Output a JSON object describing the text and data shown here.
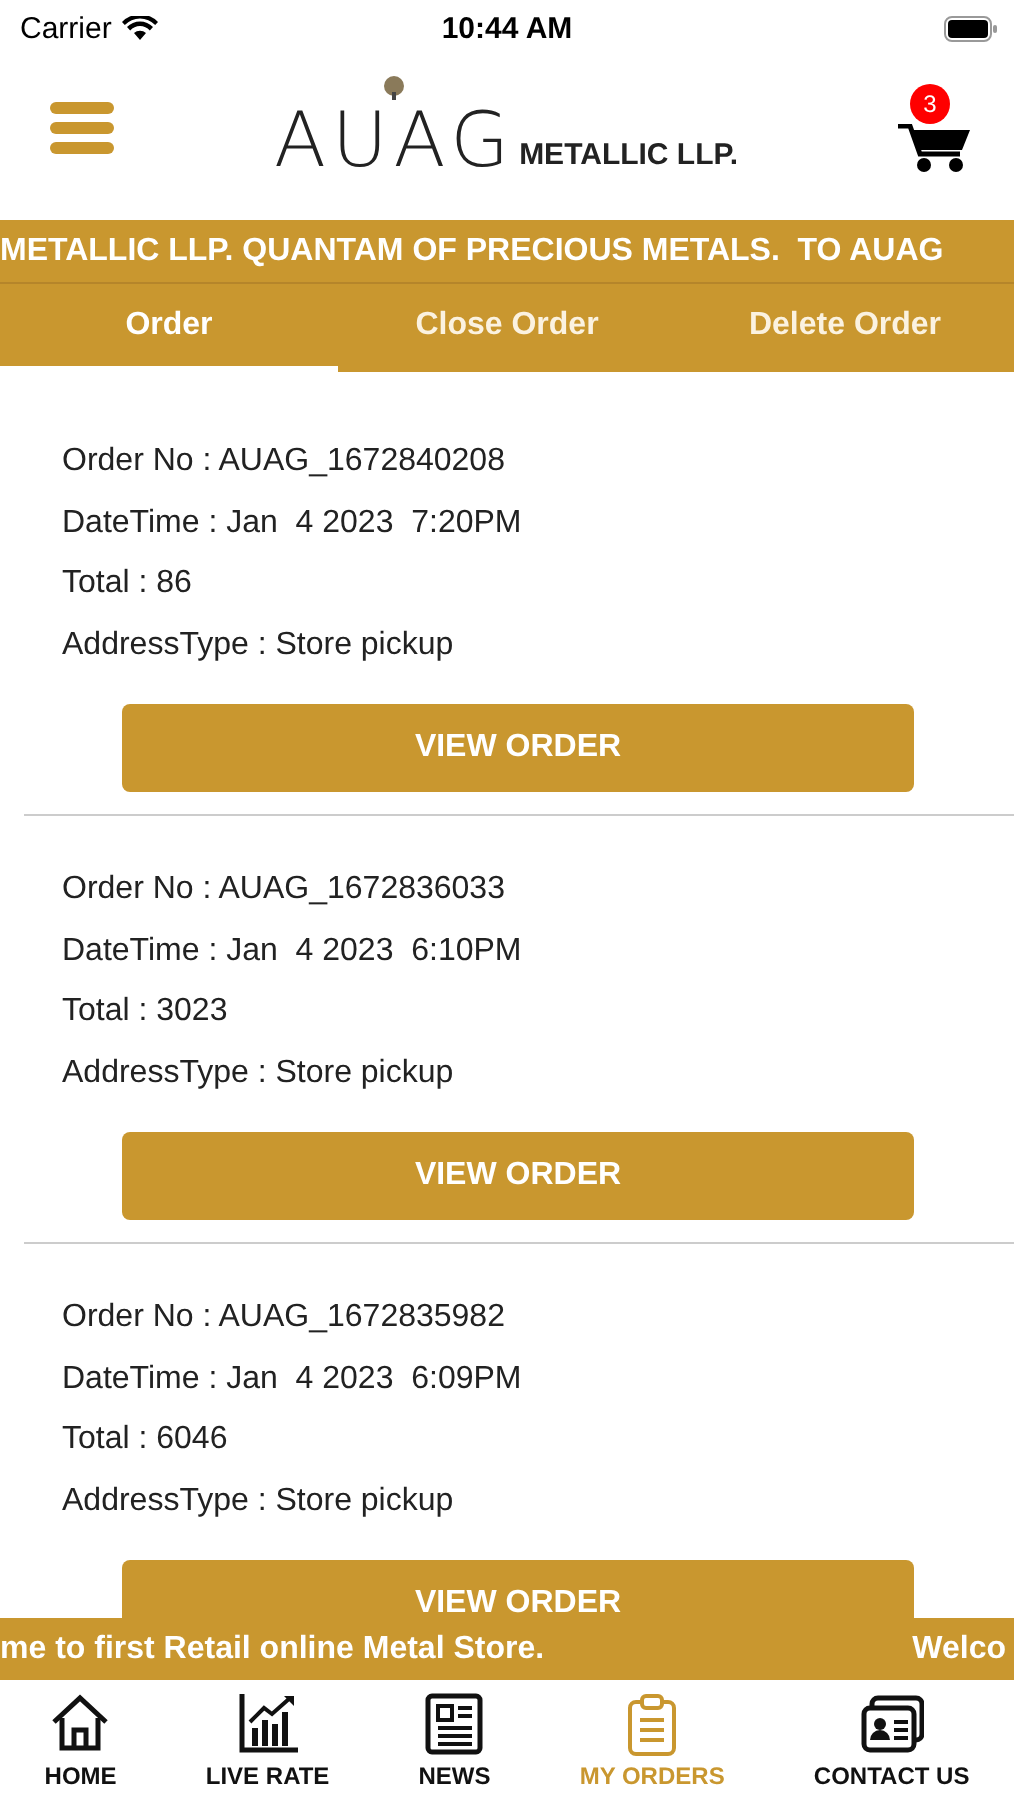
{
  "status_bar": {
    "carrier": "Carrier",
    "time": "10:44 AM"
  },
  "header": {
    "logo_letters": "AUAG",
    "logo_suffix": "METALLIC LLP.",
    "cart_count": "3"
  },
  "top_ticker": "METALLIC LLP. QUANTAM OF PRECIOUS METALS.  TO AUAG",
  "tabs": [
    {
      "label": "Order",
      "selected": true
    },
    {
      "label": "Close Order",
      "selected": false
    },
    {
      "label": "Delete Order",
      "selected": false
    }
  ],
  "orders": [
    {
      "order_no": "Order No : AUAG_1672840208",
      "datetime": "DateTime : Jan  4 2023  7:20PM",
      "total": "Total : 86",
      "address_type": "AddressType : Store pickup",
      "button": "VIEW ORDER"
    },
    {
      "order_no": "Order No : AUAG_1672836033",
      "datetime": "DateTime : Jan  4 2023  6:10PM",
      "total": "Total : 3023",
      "address_type": "AddressType : Store pickup",
      "button": "VIEW ORDER"
    },
    {
      "order_no": "Order No : AUAG_1672835982",
      "datetime": "DateTime : Jan  4 2023  6:09PM",
      "total": "Total : 6046",
      "address_type": "AddressType : Store pickup",
      "button": "VIEW ORDER"
    }
  ],
  "bottom_ticker": [
    "me to first Retail online Metal Store.",
    "Welco"
  ],
  "tab_bar": [
    {
      "kind": "home",
      "label": "HOME",
      "selected": false
    },
    {
      "kind": "chart",
      "label": "LIVE RATE",
      "selected": false
    },
    {
      "kind": "news",
      "label": "NEWS",
      "selected": false
    },
    {
      "kind": "orders",
      "label": "MY ORDERS",
      "selected": true
    },
    {
      "kind": "contact",
      "label": "CONTACT US",
      "selected": false
    }
  ]
}
